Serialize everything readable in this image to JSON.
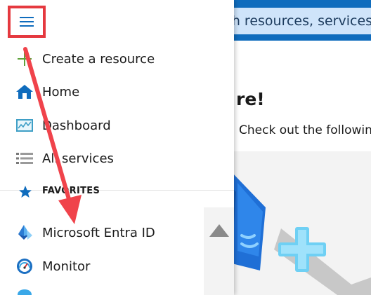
{
  "search": {
    "visible_text": "rch resources, services,"
  },
  "welcome": {
    "title": "re!",
    "subtitle": "Check out the followin"
  },
  "menu": {
    "items": [
      {
        "label": "Create a resource",
        "icon": "plus-icon"
      },
      {
        "label": "Home",
        "icon": "home-icon"
      },
      {
        "label": "Dashboard",
        "icon": "dashboard-icon"
      },
      {
        "label": "All services",
        "icon": "list-icon"
      }
    ],
    "favorites_header": "FAVORITES",
    "favorites": [
      {
        "label": "Microsoft Entra ID",
        "icon": "entra-id-icon"
      },
      {
        "label": "Monitor",
        "icon": "monitor-gauge-icon"
      }
    ]
  },
  "colors": {
    "top_bar": "#0f6cbd",
    "search_box": "#cfe4fa",
    "highlight_box": "#e5393f",
    "annotation_arrow": "#f0434b",
    "accent_blue": "#0f6cbd"
  }
}
